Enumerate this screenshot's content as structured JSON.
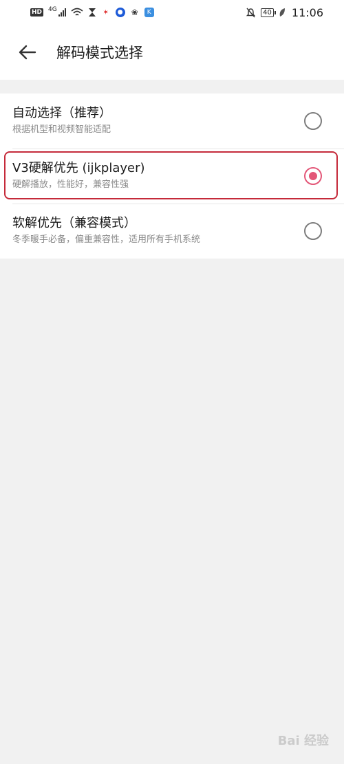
{
  "status_bar": {
    "hd": "HD",
    "network": "4G",
    "time": "11:06",
    "battery": "40"
  },
  "header": {
    "back_icon": "arrow-left-icon",
    "title": "解码模式选择"
  },
  "options": [
    {
      "title": "自动选择（推荐）",
      "subtitle": "根据机型和视频智能适配",
      "selected": false
    },
    {
      "title": "V3硬解优先 (ijkplayer)",
      "subtitle": "硬解播放，性能好，兼容性强",
      "selected": true
    },
    {
      "title": "软解优先（兼容模式）",
      "subtitle": "冬季暖手必备，偏重兼容性，适用所有手机系统",
      "selected": false
    }
  ],
  "colors": {
    "accent": "#e35778",
    "highlight_border": "#c52a3a"
  },
  "watermark": "Bai 经验"
}
